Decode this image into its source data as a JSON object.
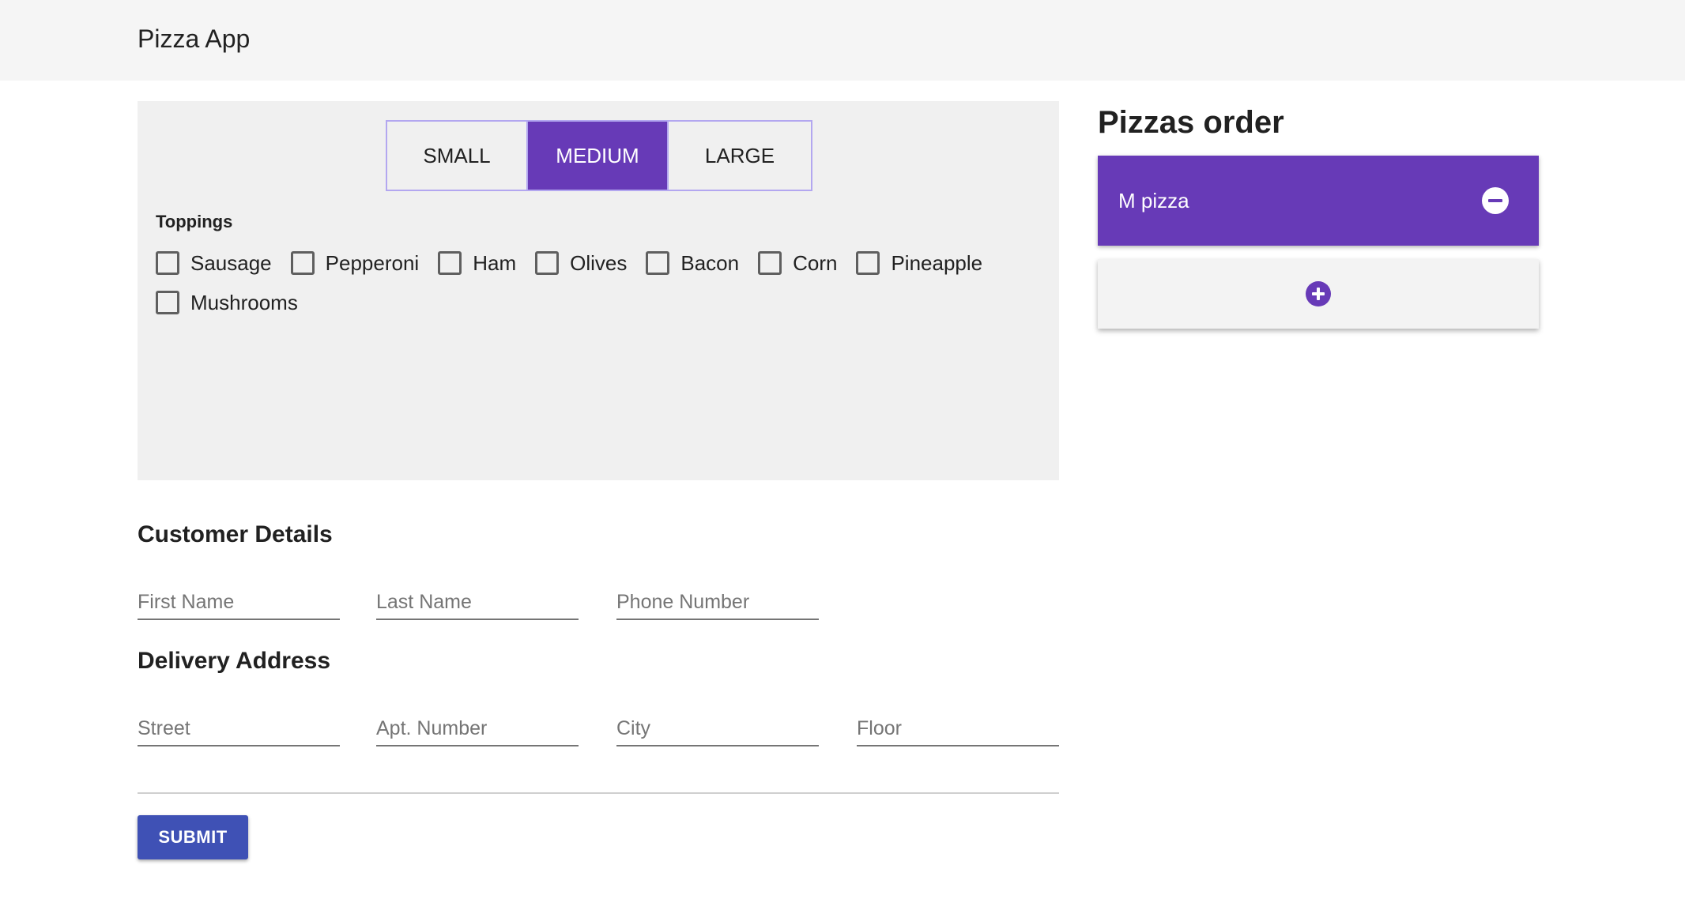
{
  "app": {
    "title": "Pizza App"
  },
  "builder": {
    "sizes": [
      {
        "label": "SMALL",
        "active": false
      },
      {
        "label": "MEDIUM",
        "active": true
      },
      {
        "label": "LARGE",
        "active": false
      }
    ],
    "toppings_label": "Toppings",
    "toppings": [
      "Sausage",
      "Pepperoni",
      "Ham",
      "Olives",
      "Bacon",
      "Corn",
      "Pineapple",
      "Mushrooms"
    ]
  },
  "customer": {
    "title": "Customer Details",
    "first_name_placeholder": "First Name",
    "last_name_placeholder": "Last Name",
    "phone_placeholder": "Phone Number"
  },
  "address": {
    "title": "Delivery Address",
    "street_placeholder": "Street",
    "apt_placeholder": "Apt. Number",
    "city_placeholder": "City",
    "floor_placeholder": "Floor"
  },
  "form": {
    "submit_label": "SUBMIT"
  },
  "order": {
    "title": "Pizzas order",
    "items": [
      {
        "label": "M pizza",
        "icon": "minus-circle-icon"
      }
    ],
    "add_icon": "plus-circle-icon"
  },
  "colors": {
    "accent": "#673ab7",
    "submit": "#3f51b5",
    "panel_bg": "#f0f0f0",
    "header_bg": "#f5f5f5"
  }
}
